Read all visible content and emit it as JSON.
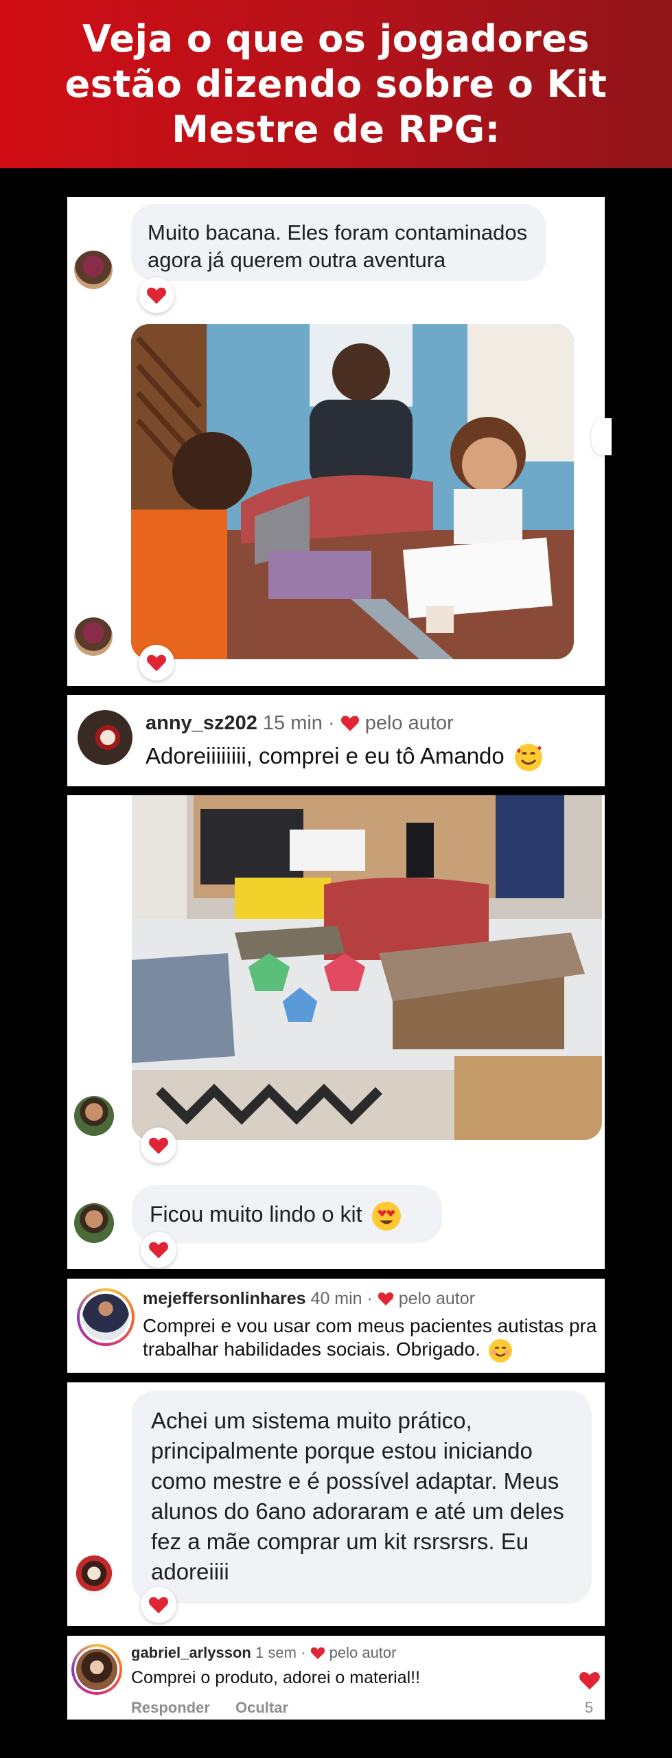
{
  "header": {
    "title": "Veja o que os jogadores estão dizendo sobre o Kit Mestre de RPG:"
  },
  "comments": [
    {
      "text": "Muito bacana. Eles foram contaminados agora já querem outra aventura"
    },
    {
      "username": "anny_sz202",
      "time": "15 min",
      "liked": "pelo autor",
      "text": "Adoreiiiiiiii, comprei e eu tô Amando",
      "emoji": "smiling-face-with-hearts"
    },
    {
      "text": "Ficou muito lindo o kit",
      "emoji": "heart-eyes"
    },
    {
      "username": "mejeffersonlinhares",
      "time": "40 min",
      "liked": "pelo autor",
      "text": "Comprei e vou usar com meus pacientes autistas pra trabalhar habilidades sociais. Obrigado.",
      "emoji": "smiling-face"
    },
    {
      "text": "Achei um sistema muito prático, principalmente porque  estou iniciando como mestre e é possível adaptar. Meus alunos do 6ano adoraram e até um deles fez a mãe comprar um kit rsrsrsrs. Eu adoreiiii"
    },
    {
      "username": "gabriel_arlysson",
      "time": "1 sem",
      "liked": "pelo autor",
      "text": "Comprei o produto, adorei o material!!",
      "actions": [
        "Responder",
        "Ocultar"
      ],
      "likes": "5"
    }
  ],
  "separator": "·",
  "colors": {
    "header_red": "#d00d14",
    "heart_red": "#e02433",
    "bubble_bg": "#f0f2f5"
  }
}
